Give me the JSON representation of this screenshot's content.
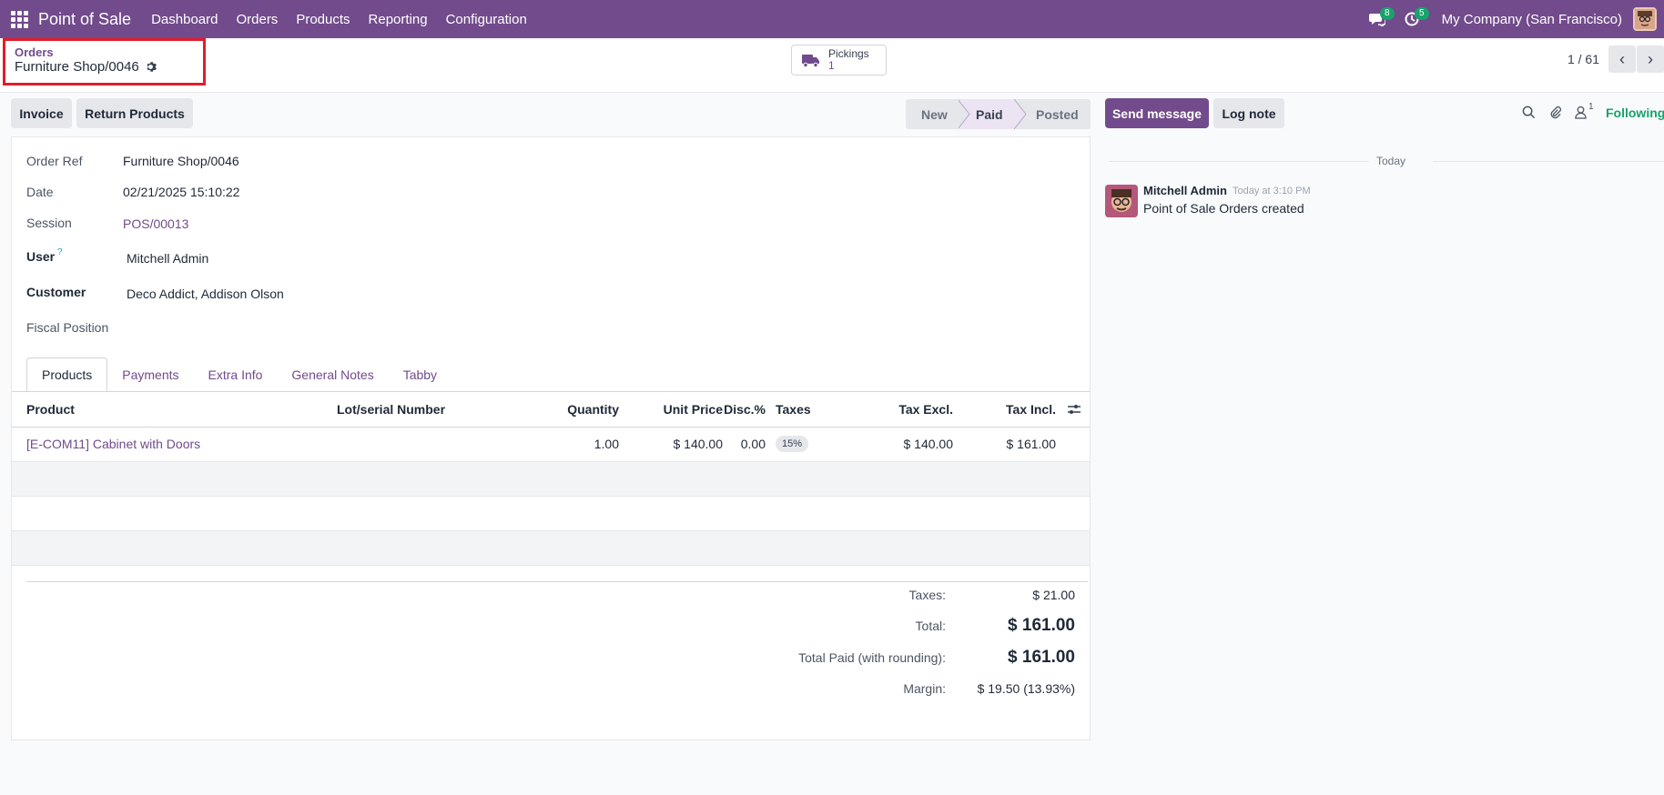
{
  "topbar": {
    "app_name": "Point of Sale",
    "menu": [
      "Dashboard",
      "Orders",
      "Products",
      "Reporting",
      "Configuration"
    ],
    "messages_count": "8",
    "activities_count": "5",
    "company": "My Company (San Francisco)"
  },
  "breadcrumb": {
    "parent": "Orders",
    "current": "Furniture Shop/0046"
  },
  "smart_button": {
    "label": "Pickings",
    "count": "1"
  },
  "pager": {
    "value": "1 / 61"
  },
  "actions": {
    "invoice": "Invoice",
    "return_products": "Return Products"
  },
  "statusbar": {
    "stages": [
      "New",
      "Paid",
      "Posted"
    ],
    "active": "Paid"
  },
  "form": {
    "order_ref_label": "Order Ref",
    "order_ref": "Furniture Shop/0046",
    "date_label": "Date",
    "date": "02/21/2025 15:10:22",
    "session_label": "Session",
    "session": "POS/00013",
    "user_label": "User",
    "user_help": "?",
    "user": "Mitchell Admin",
    "customer_label": "Customer",
    "customer": "Deco Addict, Addison Olson",
    "fiscal_label": "Fiscal Position"
  },
  "tabs": [
    "Products",
    "Payments",
    "Extra Info",
    "General Notes",
    "Tabby"
  ],
  "table": {
    "headers": {
      "product": "Product",
      "lot": "Lot/serial Number",
      "quantity": "Quantity",
      "unit_price": "Unit Price",
      "discount": "Disc.%",
      "taxes": "Taxes",
      "tax_excl": "Tax Excl.",
      "tax_incl": "Tax Incl."
    },
    "rows": [
      {
        "product": "[E-COM11] Cabinet with Doors",
        "quantity": "1.00",
        "unit_price": "$ 140.00",
        "discount": "0.00",
        "taxes": "15%",
        "tax_excl": "$ 140.00",
        "tax_incl": "$ 161.00"
      }
    ]
  },
  "totals": {
    "taxes_label": "Taxes:",
    "taxes": "$ 21.00",
    "total_label": "Total:",
    "total": "$ 161.00",
    "paid_label": "Total Paid (with rounding):",
    "paid": "$ 161.00",
    "margin_label": "Margin:",
    "margin": "$ 19.50 (13.93%)"
  },
  "chatter": {
    "send_message": "Send message",
    "log_note": "Log note",
    "followers_count": "1",
    "following": "Following",
    "date_separator": "Today",
    "message": {
      "author": "Mitchell Admin",
      "time": "Today at 3:10 PM",
      "body": "Point of Sale Orders created"
    }
  },
  "colors": {
    "brand": "#714b8b",
    "highlight_box": "#e11d2a",
    "success": "#17a36b"
  }
}
